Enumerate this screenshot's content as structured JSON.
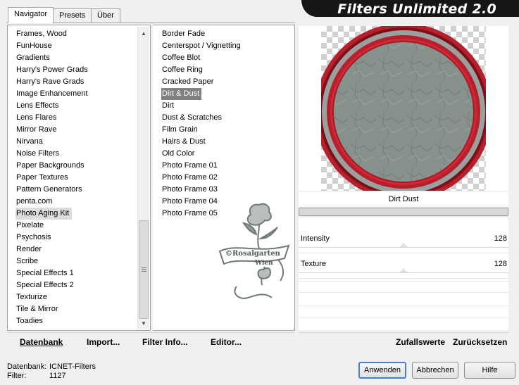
{
  "tabs": [
    {
      "label": "Navigator",
      "active": true
    },
    {
      "label": "Presets",
      "active": false
    },
    {
      "label": "Über",
      "active": false
    }
  ],
  "title": "Filters Unlimited 2.0",
  "categories": [
    "Frames, Wood",
    "FunHouse",
    "Gradients",
    "Harry's Power Grads",
    "Harry's Rave Grads",
    "Image Enhancement",
    "Lens Effects",
    "Lens Flares",
    "Mirror Rave",
    "Nirvana",
    "Noise Filters",
    "Paper Backgrounds",
    "Paper Textures",
    "Pattern Generators",
    "penta.com",
    "Photo Aging Kit",
    "Pixelate",
    "Psychosis",
    "Render",
    "Scribe",
    "Special Effects 1",
    "Special Effects 2",
    "Texturize",
    "Tile & Mirror",
    "Toadies"
  ],
  "selected_category": "Photo Aging Kit",
  "filters": [
    "Border Fade",
    "Centerspot / Vignetting",
    "Coffee Blot",
    "Coffee Ring",
    "Cracked Paper",
    "Dirt & Dust",
    "Dirt",
    "Dust & Scratches",
    "Film Grain",
    "Hairs & Dust",
    "Old Color",
    "Photo Frame 01",
    "Photo Frame 02",
    "Photo Frame 03",
    "Photo Frame 04",
    "Photo Frame 05"
  ],
  "selected_filter": "Dirt & Dust",
  "watermark": {
    "line1": "©Rosalgarten",
    "line2": "Wien"
  },
  "bottom_buttons": {
    "database": "Datenbank",
    "import": "Import...",
    "filter_info": "Filter Info...",
    "editor": "Editor..."
  },
  "preview_caption": "Dirt  Dust",
  "params": [
    {
      "label": "Intensity",
      "value": "128",
      "level": 0.5
    },
    {
      "label": "Texture",
      "value": "128",
      "level": 0.5
    }
  ],
  "right_buttons": {
    "random": "Zufallswerte",
    "reset": "Zurücksetzen"
  },
  "footer": {
    "db_label": "Datenbank:",
    "db_value": "ICNET-Filters",
    "filter_label": "Filter:",
    "filter_value": "1127"
  },
  "dialog_buttons": {
    "apply": "Anwenden",
    "cancel": "Abbrechen",
    "help": "Hilfe"
  },
  "colors": {
    "ring_red": "#b5202c",
    "disc_gray": "#8a9590",
    "banner_bg": "#161616"
  }
}
